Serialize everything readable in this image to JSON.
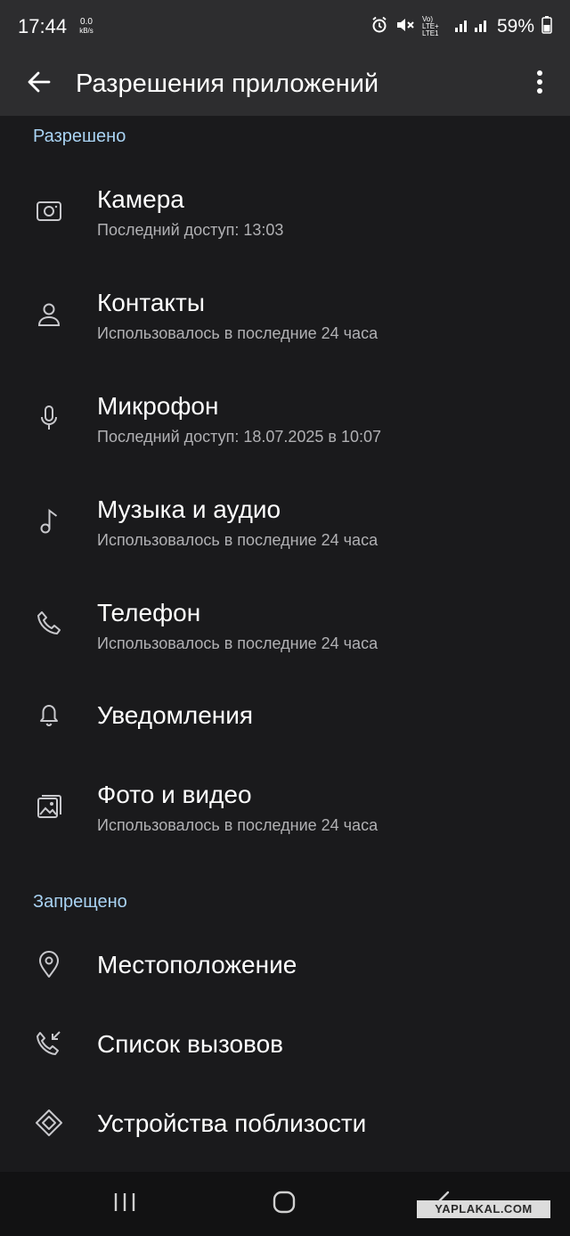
{
  "status_bar": {
    "time": "17:44",
    "speed_value": "0.0",
    "speed_unit": "kB/s",
    "network_line1": "Vo) LTE+",
    "network_line2": "LTE1",
    "battery": "59%",
    "icons": [
      "alarm-icon",
      "mute-icon",
      "signal-icon",
      "battery-icon"
    ]
  },
  "app_bar": {
    "title": "Разрешения приложений",
    "back_icon": "back-arrow-icon",
    "more_icon": "more-vert-icon"
  },
  "sections": {
    "allowed_label": "Разрешено",
    "denied_label": "Запрещено"
  },
  "allowed": [
    {
      "title": "Камера",
      "subtitle": "Последний доступ: 13:03",
      "icon": "camera-icon"
    },
    {
      "title": "Контакты",
      "subtitle": "Использовалось в последние 24 часа",
      "icon": "person-icon"
    },
    {
      "title": "Микрофон",
      "subtitle": "Последний доступ: 18.07.2025 в 10:07",
      "icon": "microphone-icon"
    },
    {
      "title": "Музыка и аудио",
      "subtitle": "Использовалось в последние 24 часа",
      "icon": "music-note-icon"
    },
    {
      "title": "Телефон",
      "subtitle": "Использовалось в последние 24 часа",
      "icon": "phone-icon"
    },
    {
      "title": "Уведомления",
      "subtitle": "",
      "icon": "bell-icon"
    },
    {
      "title": "Фото и видео",
      "subtitle": "Использовалось в последние 24 часа",
      "icon": "gallery-icon"
    }
  ],
  "denied": [
    {
      "title": "Местоположение",
      "icon": "location-pin-icon"
    },
    {
      "title": "Список вызовов",
      "icon": "call-log-icon"
    },
    {
      "title": "Устройства поблизости",
      "icon": "nearby-devices-icon"
    }
  ],
  "nav_bar": {
    "buttons": [
      "recent-apps-icon",
      "home-icon",
      "back-icon"
    ]
  },
  "watermark": "YAPLAKAL.COM",
  "colors": {
    "background": "#1a1a1c",
    "bar": "#2d2d2f",
    "section_label": "#a9d3f3",
    "subtitle": "#b1b1b4",
    "nav_bar": "#121213"
  }
}
